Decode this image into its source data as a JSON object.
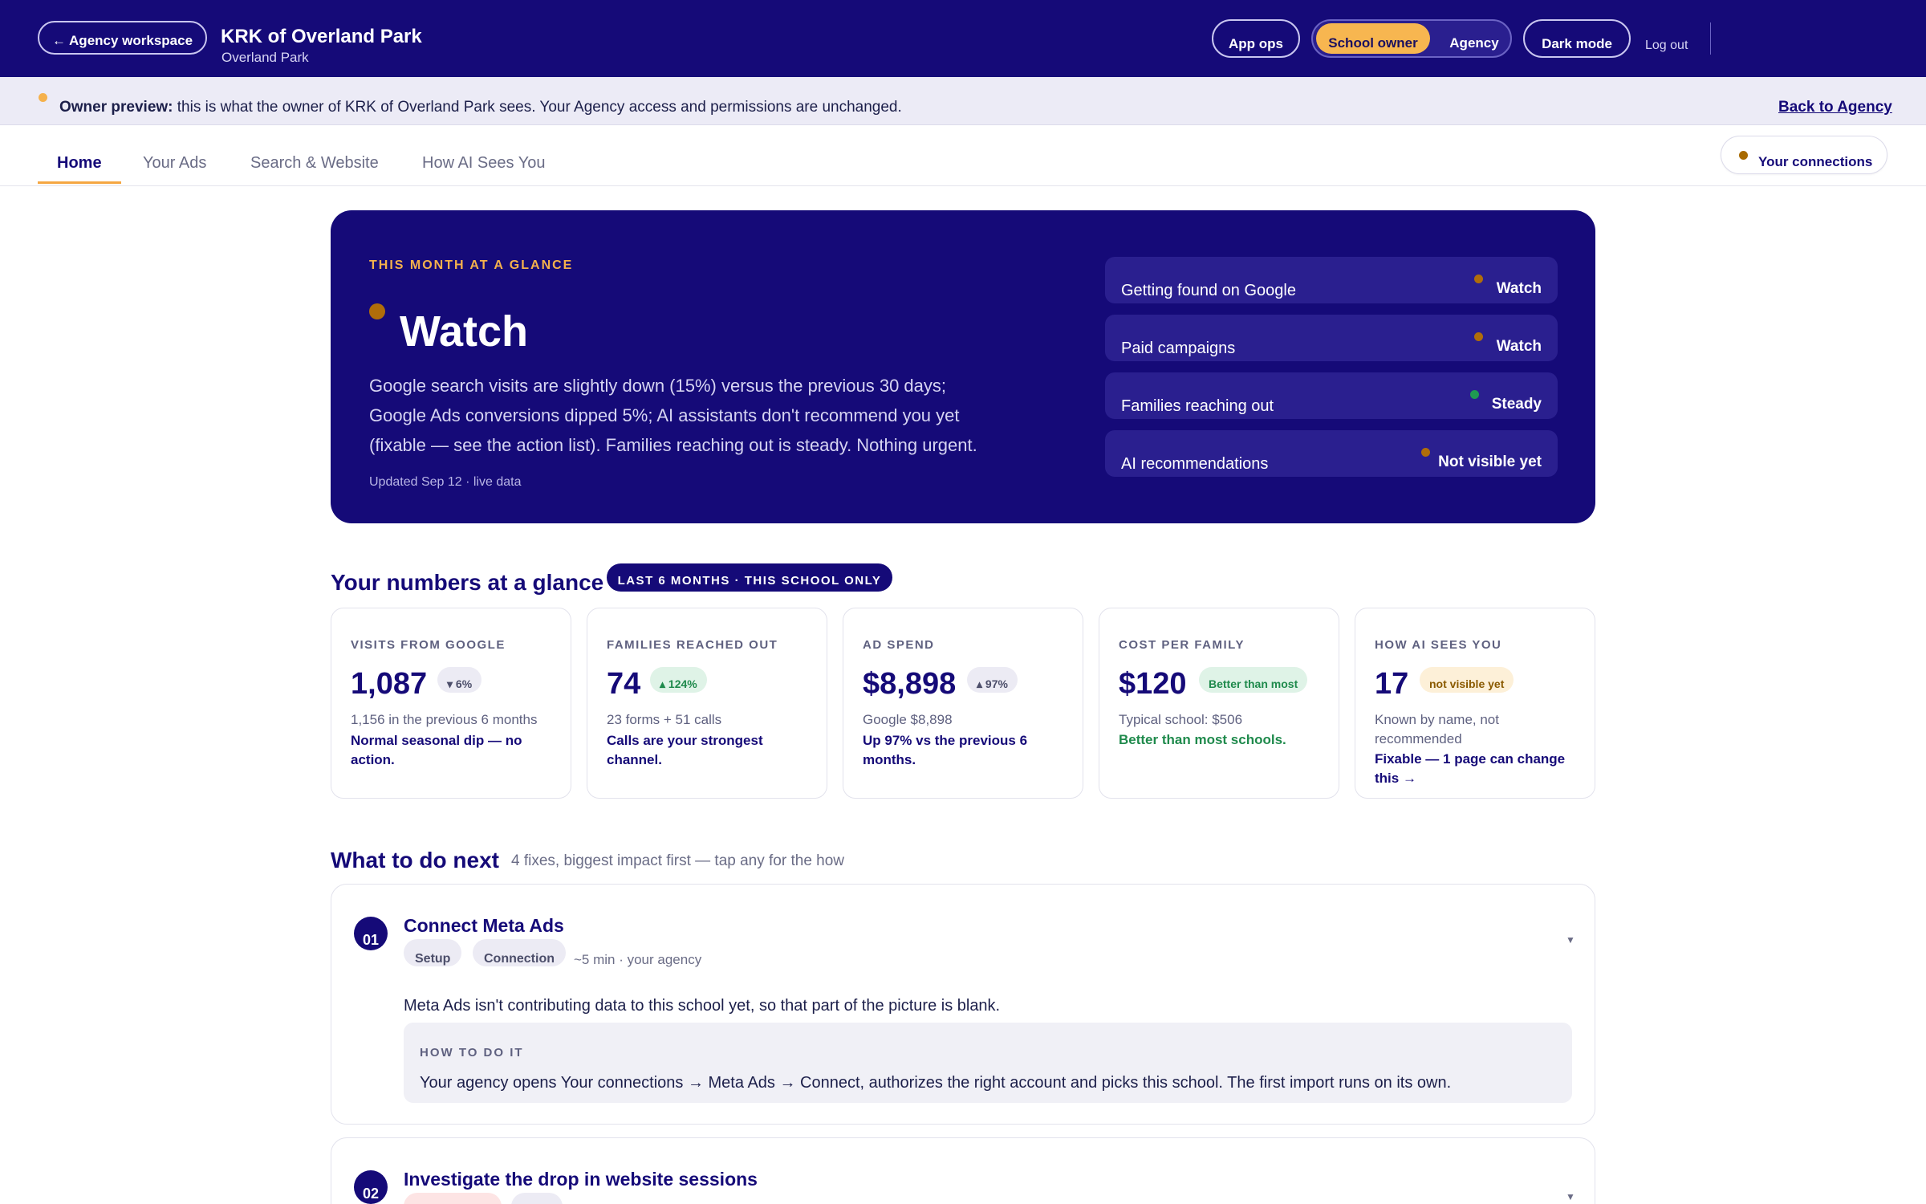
{
  "topbar": {
    "back_label": "← Agency workspace",
    "school_name": "KRK of Overland Park",
    "school_location": "Overland Park",
    "app_ops_label": "App ops",
    "role_owner_label": "School owner",
    "role_agency_label": "Agency",
    "dark_mode_label": "Dark mode",
    "logout_label": "Log out"
  },
  "banner": {
    "strong": "Owner preview:",
    "text": " this is what the owner of KRK of Overland Park sees. Your Agency access and permissions are unchanged.",
    "back_link": "Back to Agency"
  },
  "tabs": [
    {
      "label": "Home",
      "active": true
    },
    {
      "label": "Your Ads",
      "active": false
    },
    {
      "label": "Search & Website",
      "active": false
    },
    {
      "label": "How AI Sees You",
      "active": false
    }
  ],
  "connections_label": "Your connections",
  "hero": {
    "eyebrow": "THIS MONTH AT A GLANCE",
    "status": "Watch",
    "summary": "Google search visits are slightly down (15%) versus the previous 30 days; Google Ads conversions dipped 5%; AI assistants don't recommend you yet (fixable — see the action list). Families reaching out is steady. Nothing urgent.",
    "updated": "Updated Sep 12 · live data",
    "rows": [
      {
        "label": "Getting found on Google",
        "value": "Watch",
        "dot_color": "#b06d0a"
      },
      {
        "label": "Paid campaigns",
        "value": "Watch",
        "dot_color": "#b06d0a"
      },
      {
        "label": "Families reaching out",
        "value": "Steady",
        "dot_color": "#1f9a52"
      },
      {
        "label": "AI recommendations",
        "value": "Not visible yet",
        "dot_color": "#b06d0a"
      }
    ]
  },
  "numbers": {
    "title": "Your numbers at a glance",
    "range": "LAST 6 MONTHS · THIS SCHOOL ONLY",
    "cards": [
      {
        "label": "VISITS FROM GOOGLE",
        "value": "1,087",
        "delta": "▾ 6%",
        "sub": "1,156   in the previous 6 months",
        "note": "Normal seasonal dip — no action."
      },
      {
        "label": "FAMILIES REACHED OUT",
        "value": "74",
        "delta": "▴ 124%",
        "sub": "23  forms + 51  calls",
        "note": "Calls are your strongest channel."
      },
      {
        "label": "AD SPEND",
        "value": "$8,898",
        "delta": "▴ 97%",
        "sub": "Google $8,898",
        "note": "Up 97% vs the previous 6 months."
      },
      {
        "label": "COST PER FAMILY",
        "value": "$120",
        "delta": "Better than most",
        "sub": "Typical school: $506",
        "note": "Better than most schools."
      },
      {
        "label": "HOW AI SEES YOU",
        "value": "17",
        "delta": "not visible yet",
        "sub": "Known by name, not recommended",
        "note": "Fixable — 1 page can change this →"
      }
    ]
  },
  "next": {
    "title": "What to do next",
    "subtitle": "4 fixes, biggest impact first — tap any for the how",
    "tasks": [
      {
        "num": "01",
        "title": "Connect Meta Ads",
        "tags": [
          "Setup",
          "Connection"
        ],
        "meta": "~5 min · your agency",
        "body": "Meta Ads isn't contributing data to this school yet, so that part of the picture is blank.",
        "howto_label": "HOW TO DO IT",
        "howto": "Your agency opens Your connections → Meta Ads → Connect, authorizes the right account and picks this school. The first import runs on its own."
      },
      {
        "num": "02",
        "title": "Investigate the drop in website sessions"
      }
    ]
  },
  "icons": {
    "chevron": "chevron-down-icon",
    "back_arrow": "arrow-left-icon"
  }
}
